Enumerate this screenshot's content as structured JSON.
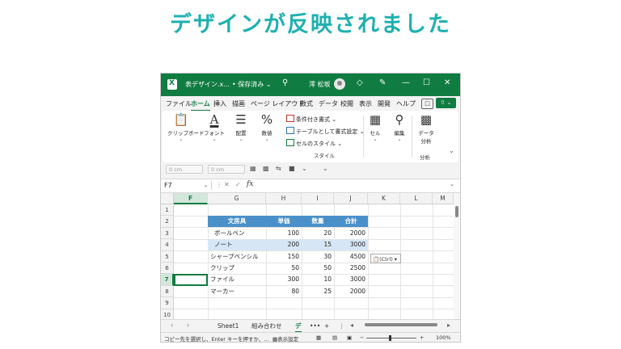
{
  "headline": "デザインが反映されました",
  "window": {
    "title": "表デザイン.x...",
    "save_state": "• 保存済み ⌄",
    "user": "澪 松坂",
    "search_icon": "magnifier-icon",
    "controls": [
      "—",
      "☐",
      "✕"
    ]
  },
  "menu": {
    "items": [
      "ファイル",
      "ホーム",
      "挿入",
      "描画",
      "ページ レイアウト",
      "数式",
      "データ",
      "校閲",
      "表示",
      "開発",
      "ヘルプ"
    ],
    "active": "ホーム"
  },
  "ribbon": {
    "clipboard": "クリップボード",
    "font": "フォント",
    "alignment": "配置",
    "number": "数値",
    "number_symbol": "%",
    "conditional_format": "条件付き書式 ⌄",
    "format_as_table": "テーブルとして書式設定 ⌄",
    "cell_styles": "セルのスタイル ⌄",
    "styles_group": "スタイル",
    "cells": "セル",
    "editing": "編集",
    "data_analysis": "データ分析",
    "analysis_group": "分析"
  },
  "quick_access": {
    "width_value": "0 cm",
    "height_value": "0 cm"
  },
  "formula_bar": {
    "name_box": "F7",
    "fx": "fx"
  },
  "grid": {
    "columns": [
      "F",
      "G",
      "H",
      "I",
      "J",
      "K",
      "L",
      "M"
    ],
    "selected_column": "F",
    "rows": [
      "1",
      "2",
      "3",
      "4",
      "5",
      "6",
      "7",
      "8",
      "9",
      "10"
    ],
    "selected_row": "7",
    "table": {
      "headers": [
        "文房具",
        "単価",
        "数量",
        "合計"
      ],
      "rows": [
        [
          "ボールペン",
          "100",
          "20",
          "2000"
        ],
        [
          "ノート",
          "200",
          "15",
          "3000"
        ],
        [
          "シャープペンシル",
          "150",
          "30",
          "4500"
        ],
        [
          "クリップ",
          "50",
          "50",
          "2500"
        ],
        [
          "ファイル",
          "300",
          "10",
          "3000"
        ],
        [
          "マーカー",
          "80",
          "25",
          "2000"
        ]
      ],
      "header_color": "#4a90c9",
      "band_color": "#d6e6f4"
    },
    "paste_options": "(Ctrl) ▾"
  },
  "sheets": {
    "tabs": [
      "Sheet1",
      "組み合わせ",
      "デ"
    ],
    "active": "デ",
    "more": "•••",
    "add": "+",
    "menu": "⋮"
  },
  "status": {
    "message": "コピー先を選択し、Enter キーを押すか、...",
    "display_settings": "表示設定",
    "zoom_minus": "−",
    "zoom_plus": "+",
    "zoom": "100%"
  },
  "colors": {
    "excel_green": "#107c41",
    "headline_teal": "#1fb0b0"
  }
}
